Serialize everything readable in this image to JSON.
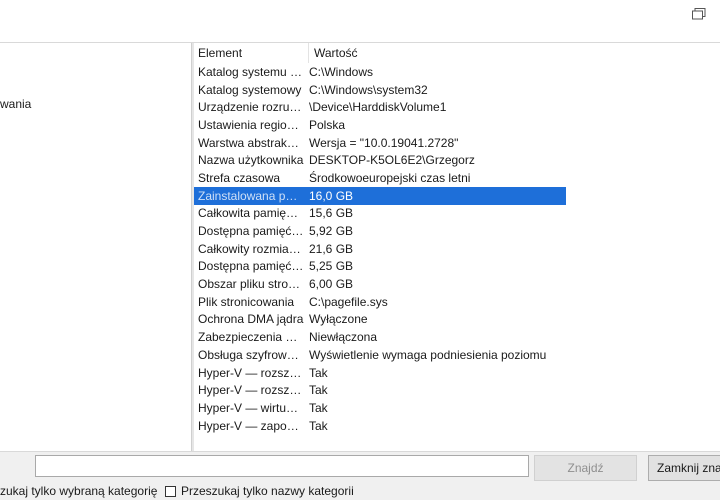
{
  "tree": {
    "visible_item_fragment": "wania"
  },
  "columns": {
    "element": "Element",
    "value": "Wartość"
  },
  "rows": [
    {
      "element": "Katalog systemu Wi...",
      "value": "C:\\Windows"
    },
    {
      "element": "Katalog systemowy",
      "value": "C:\\Windows\\system32"
    },
    {
      "element": "Urządzenie rozrucho...",
      "value": "\\Device\\HarddiskVolume1"
    },
    {
      "element": "Ustawienia regionalne",
      "value": "Polska"
    },
    {
      "element": "Warstwa abstrakcji s...",
      "value": "Wersja = \"10.0.19041.2728\""
    },
    {
      "element": "Nazwa użytkownika",
      "value": "DESKTOP-K5OL6E2\\Grzegorz"
    },
    {
      "element": "Strefa czasowa",
      "value": "Środkowoeuropejski czas letni"
    },
    {
      "element": "Zainstalowana pami...",
      "value": "16,0 GB"
    },
    {
      "element": "Całkowita pamięć fiz...",
      "value": "15,6 GB"
    },
    {
      "element": "Dostępna pamięć fiz...",
      "value": "5,92 GB"
    },
    {
      "element": "Całkowity rozmiar p...",
      "value": "21,6 GB"
    },
    {
      "element": "Dostępna pamięć wi...",
      "value": "5,25 GB"
    },
    {
      "element": "Obszar pliku stronic...",
      "value": "6,00 GB"
    },
    {
      "element": "Plik stronicowania",
      "value": "C:\\pagefile.sys"
    },
    {
      "element": "Ochrona DMA jądra",
      "value": "Wyłączone"
    },
    {
      "element": "Zabezpieczenia opar...",
      "value": "Niewłączona"
    },
    {
      "element": "Obsługa szyfrowania...",
      "value": "Wyświetlenie wymaga podniesienia poziomu"
    },
    {
      "element": "Hyper-V — rozszerz...",
      "value": "Tak"
    },
    {
      "element": "Hyper-V — rozszerz...",
      "value": "Tak"
    },
    {
      "element": "Hyper-V — wirtualiz...",
      "value": "Tak"
    },
    {
      "element": "Hyper-V — zapobie...",
      "value": "Tak"
    }
  ],
  "selected_row": 7,
  "colors": {
    "selection": "#1e6fd9",
    "panel_bg": "#f0f0f0"
  },
  "search": {
    "value": "",
    "placeholder": ""
  },
  "buttons": {
    "find": "Znajdź",
    "close": "Zamknij znaj"
  },
  "checkboxes": {
    "selected_category": "zukaj tylko wybraną kategorię",
    "category_names": "Przeszukaj tylko nazwy kategorii"
  },
  "icons": {
    "top_right": "restore-window-icon"
  }
}
